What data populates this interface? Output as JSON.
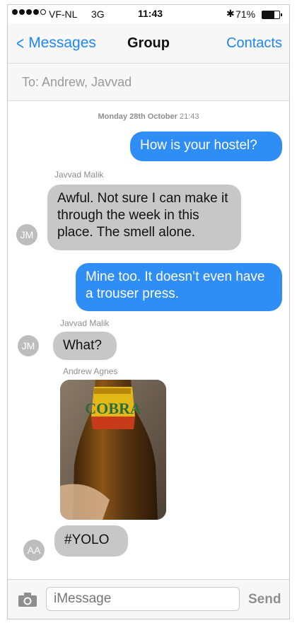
{
  "status_bar": {
    "carrier": "VF-NL",
    "network": "3G",
    "time": "11:43",
    "bluetooth_icon": "bluetooth-icon",
    "battery_percent": "71%",
    "battery_level": 0.71,
    "signal_strength": 4
  },
  "nav": {
    "back_label": "Messages",
    "title": "Group",
    "contacts_label": "Contacts"
  },
  "to_bar": {
    "text": "To: Andrew, Javvad"
  },
  "timestamp": {
    "day": "Monday 28th October",
    "time": "21:43"
  },
  "messages": [
    {
      "direction": "out",
      "text": "How is your hostel?"
    },
    {
      "direction": "in",
      "sender": "Javvad Malik",
      "initials": "JM",
      "text": "Awful. Not sure I can make it through the week in this place. The smell alone."
    },
    {
      "direction": "out",
      "text": "Mine too. It doesn’t even have a trouser press."
    },
    {
      "direction": "in",
      "sender": "Javvad Malik",
      "initials": "JM",
      "text": "What?"
    },
    {
      "direction": "in",
      "sender": "Andrew Agnes",
      "initials": "AA",
      "image": "beer-bottle-photo",
      "image_label": "COBRA",
      "text": "#YOLO"
    }
  ],
  "input_bar": {
    "camera_icon": "camera-icon",
    "placeholder": "iMessage",
    "send_label": "Send"
  },
  "colors": {
    "accent": "#1e86f5",
    "outgoing": "#2f8df6",
    "incoming": "#c7c7c7"
  }
}
